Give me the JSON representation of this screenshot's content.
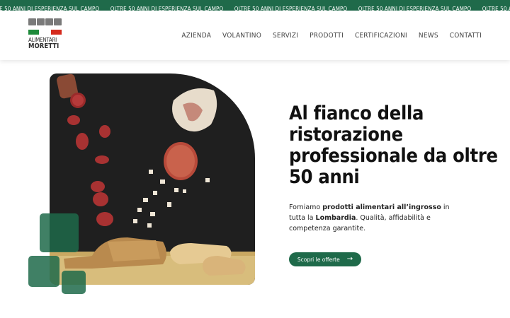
{
  "ticker": {
    "items": [
      "OLTRE 50 ANNI DI ESPERIENZA SUL CAMPO",
      "OLTRE 50 ANNI DI ESPERIENZA SUL CAMPO",
      "OLTRE 50 ANNI DI ESPERIENZA SUL CAMPO",
      "OLTRE 50 ANNI DI ESPERIENZA SUL CAMPO",
      "OLTRE 50 ANNI DI ESPERIENZA SUL CAMPO"
    ]
  },
  "logo": {
    "line1": "ALIMENTARI",
    "line2": "MORETTI"
  },
  "nav": {
    "items": [
      "AZIENDA",
      "VOLANTINO",
      "SERVIZI",
      "PRODOTTI",
      "CERTIFICAZIONI",
      "NEWS",
      "CONTATTI"
    ]
  },
  "hero": {
    "title": "Al fianco della ristorazione professionale da oltre 50 anni",
    "desc_1": "Forniamo ",
    "desc_bold_1": "prodotti alimentari all’ingrosso",
    "desc_2": " in tutta la ",
    "desc_bold_2": "Lombardia",
    "desc_3": ". Qualità, affidabilità e competenza garantite.",
    "cta_label": "Scopri le offerte",
    "cta_icon": "arrow-right-icon"
  },
  "colors": {
    "brand_green": "#1f6a4a",
    "flag_green": "#1f8a3b",
    "flag_red": "#d52b1e",
    "hero_bg": "#1f1f1f"
  }
}
